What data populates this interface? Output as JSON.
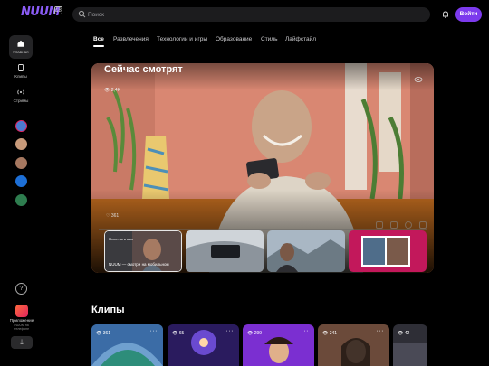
{
  "brand": {
    "logo": "NUUM",
    "badge": "18"
  },
  "search": {
    "placeholder": "Поиск"
  },
  "header": {
    "login_label": "Войти"
  },
  "sidebar": {
    "items": [
      {
        "label": "Главная",
        "icon": "home-icon"
      },
      {
        "label": "Клипы",
        "icon": "clips-icon"
      },
      {
        "label": "Стримы",
        "icon": "streams-icon"
      }
    ],
    "channels": [
      "#4a7bd0",
      "#c89a7a",
      "#a67860",
      "#1d6fd6",
      "#2e7d4f"
    ],
    "app": {
      "title": "Приложение",
      "subtitle": "NUUM на телефоне"
    }
  },
  "tabs": [
    "Все",
    "Развлечения",
    "Технологии и игры",
    "Образование",
    "Стиль",
    "Лайфстайл"
  ],
  "hero": {
    "title": "Сейчас смотрят",
    "views": "2,4K",
    "likes": "361",
    "thumbs": [
      {
        "caption": "NUUM — смотри на мобильном",
        "caption_top": "Мать пять мин"
      },
      {
        "caption": ""
      },
      {
        "caption": ""
      },
      {
        "caption": ""
      }
    ]
  },
  "clips": {
    "title": "Клипы",
    "items": [
      {
        "views": "361"
      },
      {
        "views": "65"
      },
      {
        "views": "299"
      },
      {
        "views": "241"
      },
      {
        "views": "42"
      }
    ]
  },
  "colors": {
    "accent": "#7c3aed",
    "background": "#000000",
    "hero_wall": "#d98772"
  }
}
